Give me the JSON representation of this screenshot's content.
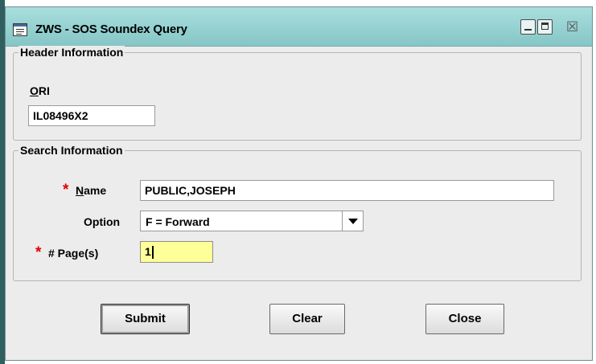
{
  "window": {
    "title": "ZWS - SOS Soundex Query",
    "icons": [
      "app-icon",
      "minimize-icon",
      "maximize-icon",
      "close-icon"
    ]
  },
  "header_info": {
    "legend": "Header Information",
    "ori_label_mnemonic": "O",
    "ori_label_rest": "RI",
    "ori_value": "IL08496X2"
  },
  "search_info": {
    "legend": "Search Information",
    "required_marker": "*",
    "name_label_mnemonic": "N",
    "name_label_rest": "ame",
    "name_value": "PUBLIC,JOSEPH",
    "option_label": "Option",
    "option_value": "F = Forward",
    "pages_label": "# Page(s)",
    "pages_value": "1"
  },
  "buttons": {
    "submit": "Submit",
    "clear": "Clear",
    "close": "Close"
  },
  "colors": {
    "titlebar": "#a9dede",
    "required": "#e00000",
    "focused_field": "#ffff99"
  }
}
